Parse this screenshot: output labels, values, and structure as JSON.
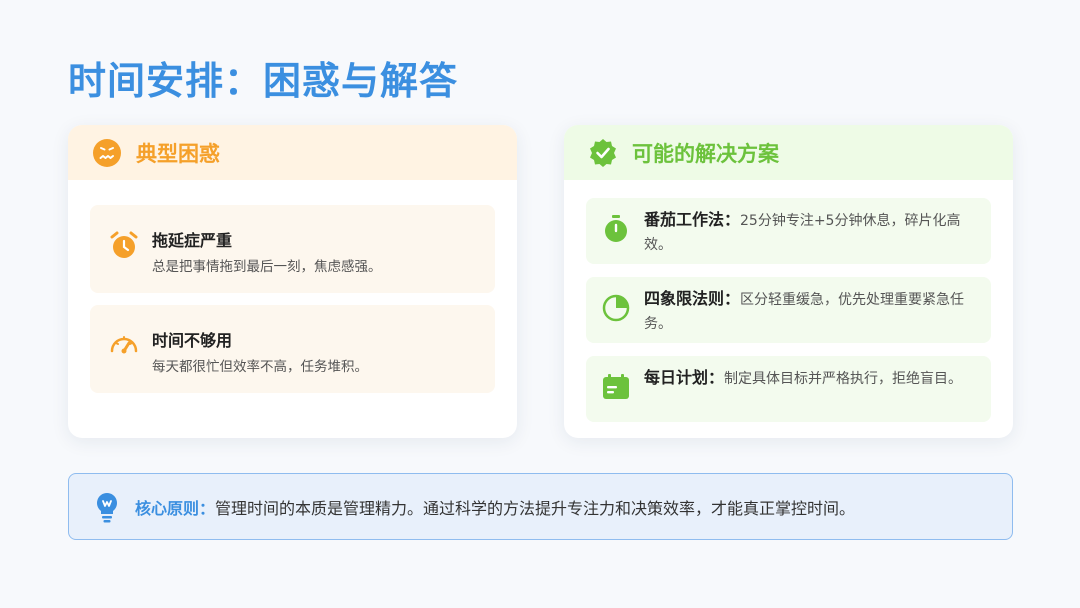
{
  "title": "时间安排：困惑与解答",
  "colors": {
    "title": "#3b8fe0",
    "problems_accent": "#f5a02a",
    "solutions_accent": "#6cc23c"
  },
  "problems": {
    "heading": "典型困惑",
    "heading_icon": "worried-face-icon",
    "items": [
      {
        "icon": "alarm-clock-icon",
        "title": "拖延症严重",
        "desc": "总是把事情拖到最后一刻，焦虑感强。"
      },
      {
        "icon": "speedometer-icon",
        "title": "时间不够用",
        "desc": "每天都很忙但效率不高，任务堆积。"
      }
    ]
  },
  "solutions": {
    "heading": "可能的解决方案",
    "heading_icon": "check-badge-icon",
    "items": [
      {
        "icon": "stopwatch-icon",
        "title": "番茄工作法：",
        "desc": "25分钟专注+5分钟休息，碎片化高效。"
      },
      {
        "icon": "pie-chart-icon",
        "title": "四象限法则：",
        "desc": "区分轻重缓急，优先处理重要紧急任务。"
      },
      {
        "icon": "calendar-icon",
        "title": "每日计划：",
        "desc": "制定具体目标并严格执行，拒绝盲目。"
      }
    ]
  },
  "principle": {
    "icon": "lightbulb-icon",
    "label": "核心原则：",
    "text": "管理时间的本质是管理精力。通过科学的方法提升专注力和决策效率，才能真正掌控时间。"
  }
}
